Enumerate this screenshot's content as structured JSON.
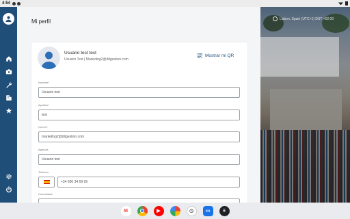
{
  "status_bar": {
    "time": "4:54"
  },
  "sidebar": {
    "items": [
      {
        "name": "home",
        "icon": "home-icon"
      },
      {
        "name": "badge",
        "icon": "id-card-icon"
      },
      {
        "name": "tools",
        "icon": "wrench-icon"
      },
      {
        "name": "building",
        "icon": "building-icon"
      },
      {
        "name": "favorites",
        "icon": "star-icon"
      },
      {
        "name": "settings",
        "icon": "gear-icon"
      },
      {
        "name": "logout",
        "icon": "power-icon"
      }
    ]
  },
  "page": {
    "title": "Mi perfil"
  },
  "profile": {
    "name": "Usuario test test",
    "subtitle": "Usuario Test | Marketing2@ditgestion.com",
    "qr_label": "Mostrar mi QR"
  },
  "form": {
    "fields": [
      {
        "label": "Nombre*",
        "value": "Usuario test"
      },
      {
        "label": "Apellido*",
        "value": "test"
      },
      {
        "label": "Correo*",
        "value": "marketing2@ditgestion.com"
      },
      {
        "label": "Agencia",
        "value": "Usuario test"
      },
      {
        "label": "Teléfono",
        "value": "+34 600 34 69 99"
      },
      {
        "label": "Comunidad",
        "value": ""
      }
    ]
  },
  "photo_panel": {
    "timezone_text": "Lisbon, Spain (UTC+1) DST +02:00"
  },
  "taskbar": {
    "apps": [
      {
        "name": "gmail",
        "color": "#ffffff"
      },
      {
        "name": "chrome",
        "color": "#4285f4"
      },
      {
        "name": "youtube",
        "color": "#ff0000"
      },
      {
        "name": "photos",
        "color": "#fbbc05"
      },
      {
        "name": "clock",
        "color": "#e0e0e0"
      },
      {
        "name": "messages",
        "color": "#1a73e8"
      },
      {
        "name": "app-drawer",
        "color": "#202124"
      }
    ]
  },
  "colors": {
    "sidebar": "#1f4e79",
    "accent": "#1f4e79"
  }
}
